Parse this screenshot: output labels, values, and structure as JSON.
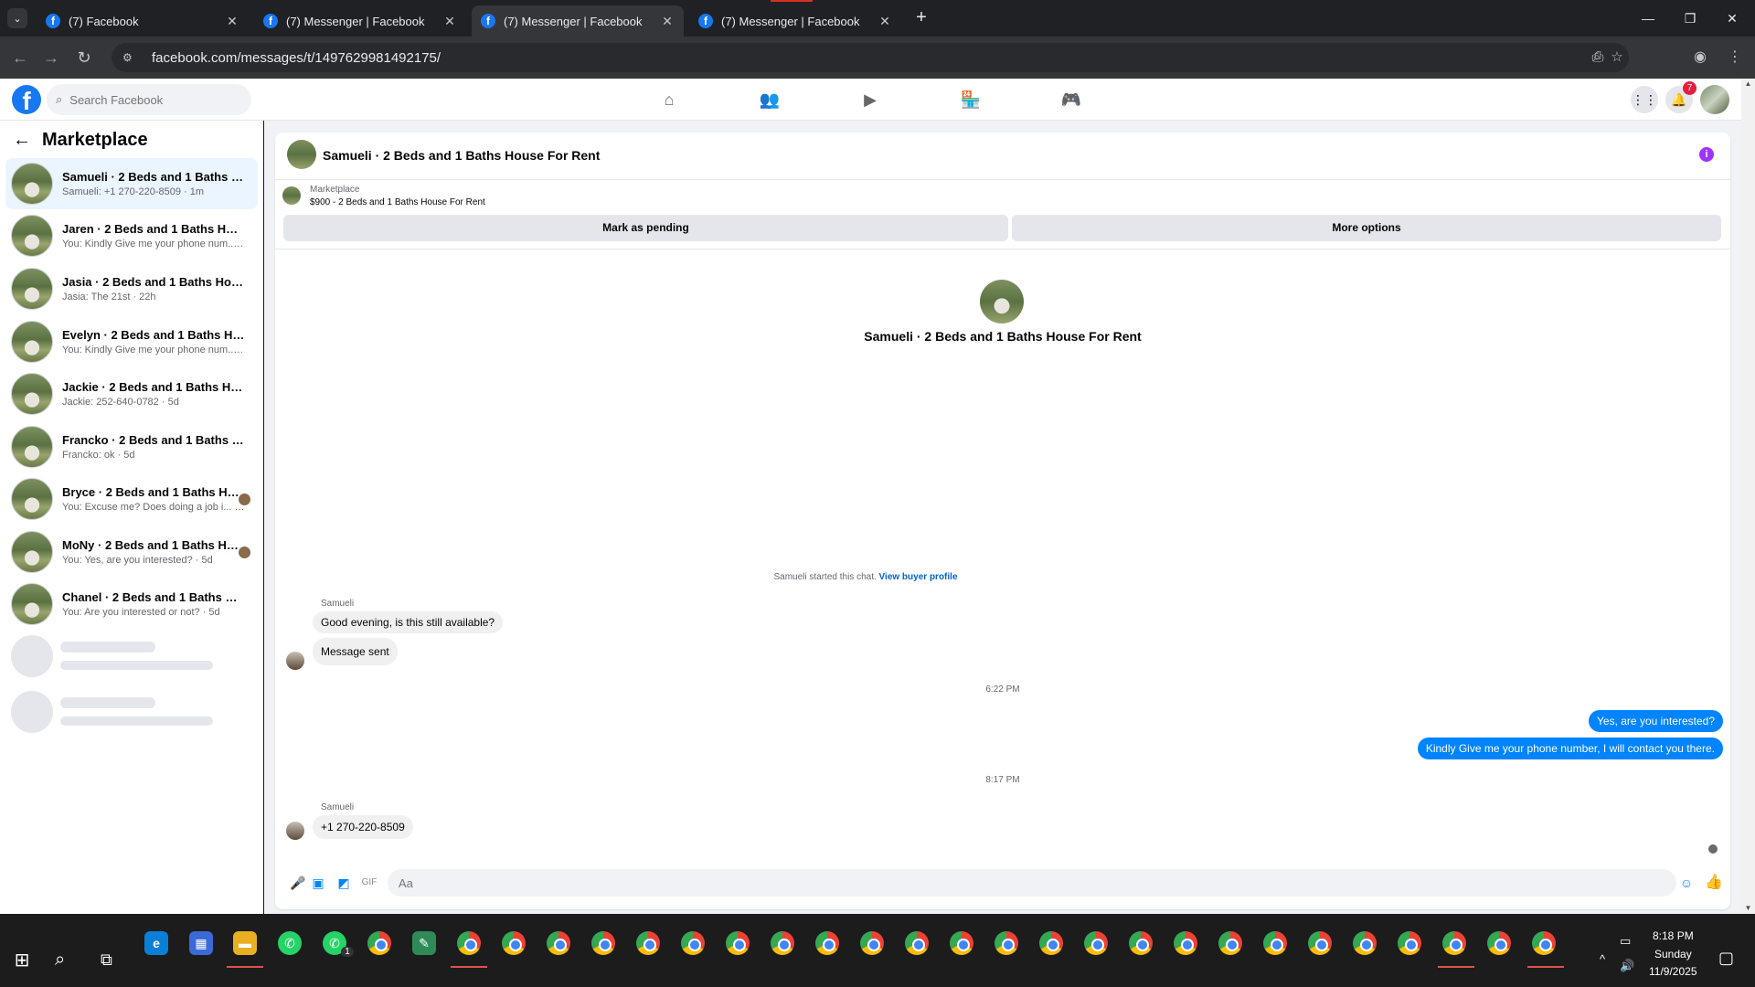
{
  "browser": {
    "tabs": [
      {
        "title": "(7) Facebook",
        "active": false
      },
      {
        "title": "(7) Messenger | Facebook",
        "active": false
      },
      {
        "title": "(7) Messenger | Facebook",
        "active": true
      },
      {
        "title": "(7) Messenger | Facebook",
        "active": false
      }
    ],
    "url": "facebook.com/messages/t/1497629981492175/"
  },
  "header": {
    "search_placeholder": "Search Facebook",
    "notifications_count": "7",
    "brand_color": "#1877f2"
  },
  "left_panel": {
    "title": "Marketplace",
    "conversations": [
      {
        "name": "Samueli · 2 Beds and 1 Baths House For Rent",
        "sub": "Samueli: +1 270-220-8509 · 1m",
        "active": true
      },
      {
        "name": "Jaren · 2 Beds and 1 Baths House For Rent",
        "sub": "You: Kindly Give me your phone num... · 1h"
      },
      {
        "name": "Jasia · 2 Beds and 1 Baths House For Rent",
        "sub": "Jasia: The 21st · 22h"
      },
      {
        "name": "Evelyn · 2 Beds and 1 Baths House For Rent",
        "sub": "You: Kindly Give me your phone num... · 4d"
      },
      {
        "name": "Jackie · 2 Beds and 1 Baths House For Rent",
        "sub": "Jackie: 252-640-0782 · 5d"
      },
      {
        "name": "Francko · 2 Beds and 1 Baths House For Rent",
        "sub": "Francko: ok · 5d"
      },
      {
        "name": "Bryce · 2 Beds and 1 Baths House For Rent",
        "sub": "You: Excuse me? Does doing a job i... · 5d",
        "seen": true
      },
      {
        "name": "MoNy · 2 Beds and 1 Baths House For Rent",
        "sub": "You: Yes, are you interested? · 5d",
        "seen": true
      },
      {
        "name": "Chanel · 2 Beds and 1 Baths House For Rent",
        "sub": "You: Are you interested or not? · 5d"
      }
    ]
  },
  "chat": {
    "title": "Samueli · 2 Beds and 1 Baths House For Rent",
    "listing_source": "Marketplace",
    "listing_price": "$900 - 2 Beds and 1 Baths House For Rent",
    "mark_pending_label": "Mark as pending",
    "more_options_label": "More options",
    "intro_title": "Samueli · 2 Beds and 1 Baths House For Rent",
    "started_text": "Samueli started this chat.",
    "view_profile_label": "View buyer profile",
    "messages": [
      {
        "sender": "Samueli",
        "text": "Good evening, is this still available?",
        "direction": "in"
      },
      {
        "text": "Message sent",
        "direction": "in"
      },
      {
        "time": "6:22 PM"
      },
      {
        "text": "Yes, are you interested?",
        "direction": "out"
      },
      {
        "text": "Kindly Give me your phone number, I will contact you there.",
        "direction": "out"
      },
      {
        "time": "8:17 PM"
      },
      {
        "sender": "Samueli",
        "text": "+1 270-220-8509",
        "direction": "in"
      }
    ],
    "composer_placeholder": "Aa",
    "accent_color": "#0084ff"
  },
  "taskbar": {
    "time": "8:18 PM",
    "day": "Sunday",
    "date": "11/9/2025",
    "whatsapp_badge": "1"
  }
}
